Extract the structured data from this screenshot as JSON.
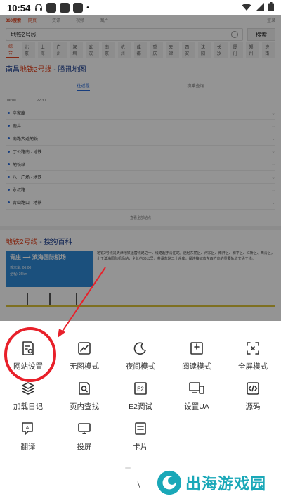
{
  "status_bar": {
    "time": "10:54"
  },
  "page": {
    "top_nav": {
      "logo": "360搜索",
      "items": [
        "网页",
        "资讯",
        "视频",
        "图片"
      ],
      "active_index": 0,
      "right": "登录"
    },
    "search": {
      "query": "地铁2号线",
      "button": "搜索"
    },
    "channels": [
      "综合",
      "北京",
      "上海",
      "广州",
      "深圳",
      "武汉",
      "南京",
      "杭州",
      "成都",
      "重庆",
      "天津",
      "西安",
      "沈阳",
      "长沙",
      "厦门",
      "郑州",
      "济南"
    ],
    "result1": {
      "keyword": "地铁2号线",
      "title_prefix": "南昌",
      "title_suffix": " - 腾讯地图"
    },
    "map_tabs": [
      "往返程",
      "换乘查询"
    ],
    "directions": [
      "06:00",
      "22:30"
    ],
    "stations": [
      "辛家庵",
      "鹿井",
      "南路大道地铁",
      "丁公路南 · 地铁",
      "地铁站",
      "八一广场 · 地铁",
      "永叔路",
      "青山路口 · 地铁"
    ],
    "collapse_label": "查看全部站点",
    "result2": {
      "keyword": "地铁2号线",
      "title_suffix": " - 搜狗百科"
    },
    "metro_card": {
      "line1": "青庄 ⟶ 滨海国际机场",
      "line2": "首末车: 06:00",
      "line3": "全程: 36km"
    },
    "result2_text": "地铁2号线是天津地铁运营线路之一，线路起于青庄站，途经东丽区、河东区、南开区、和平区、红桥区、西青区，止于滨海国际机场站，全长约36公里，共设车站二十余座，是连接城市东西方向的重要轨道交通干线。"
  },
  "menu": {
    "items": [
      {
        "label": "网站设置",
        "icon": "site-settings-icon"
      },
      {
        "label": "无图模式",
        "icon": "no-image-icon"
      },
      {
        "label": "夜间模式",
        "icon": "moon-icon"
      },
      {
        "label": "阅读模式",
        "icon": "reader-icon"
      },
      {
        "label": "全屏模式",
        "icon": "fullscreen-icon"
      },
      {
        "label": "加载日记",
        "icon": "layers-icon"
      },
      {
        "label": "页内查找",
        "icon": "find-in-page-icon"
      },
      {
        "label": "E2调试",
        "icon": "e2-debug-icon"
      },
      {
        "label": "设置UA",
        "icon": "user-agent-icon"
      },
      {
        "label": "源码",
        "icon": "source-code-icon"
      },
      {
        "label": "翻译",
        "icon": "translate-icon"
      },
      {
        "label": "投屏",
        "icon": "cast-icon"
      },
      {
        "label": "卡片",
        "icon": "card-icon"
      }
    ]
  },
  "watermark": {
    "text": "出海游戏园"
  },
  "colors": {
    "annotation": "#e8202a",
    "accent": "#e2431e",
    "watermark": "#1aa8b8"
  }
}
